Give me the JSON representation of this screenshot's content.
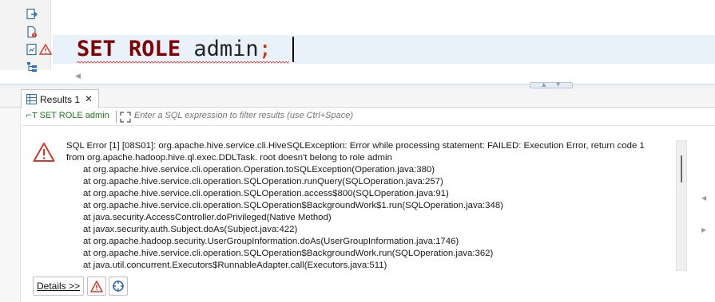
{
  "editor": {
    "code": {
      "keyword_set": "SET",
      "keyword_role": "ROLE",
      "identifier": "admin",
      "terminator": ";"
    },
    "gutter_icons": [
      "export-data-icon",
      "script-file-icon",
      "explain-plan-icon",
      "warning-icon",
      "structure-icon"
    ]
  },
  "results": {
    "tab_label": "Results 1",
    "query_label": "SET ROLE admin",
    "filter_placeholder": "Enter a SQL expression to filter results (use Ctrl+Space)",
    "error": {
      "headline_1": "SQL Error [1] [08S01]: org.apache.hive.service.cli.HiveSQLException: Error while processing statement: FAILED: Execution Error, return code 1",
      "headline_2": "from org.apache.hadoop.hive.ql.exec.DDLTask. root doesn't belong to role admin",
      "stack": [
        "at org.apache.hive.service.cli.operation.Operation.toSQLException(Operation.java:380)",
        "at org.apache.hive.service.cli.operation.SQLOperation.runQuery(SQLOperation.java:257)",
        "at org.apache.hive.service.cli.operation.SQLOperation.access$800(SQLOperation.java:91)",
        "at org.apache.hive.service.cli.operation.SQLOperation$BackgroundWork$1.run(SQLOperation.java:348)",
        "at java.security.AccessController.doPrivileged(Native Method)",
        "at javax.security.auth.Subject.doAs(Subject.java:422)",
        "at org.apache.hadoop.security.UserGroupInformation.doAs(UserGroupInformation.java:1746)",
        "at org.apache.hive.service.cli.operation.SQLOperation$BackgroundWork.run(SQLOperation.java:362)",
        "at java.util.concurrent.Executors$RunnableAdapter.call(Executors.java:511)"
      ]
    },
    "details_button_label": "Details >>",
    "colors": {
      "keyword": "#7f0000",
      "query_label": "#1d7a1d",
      "error_icon": "#d33a2c",
      "current_line": "#e9f1fb"
    }
  }
}
